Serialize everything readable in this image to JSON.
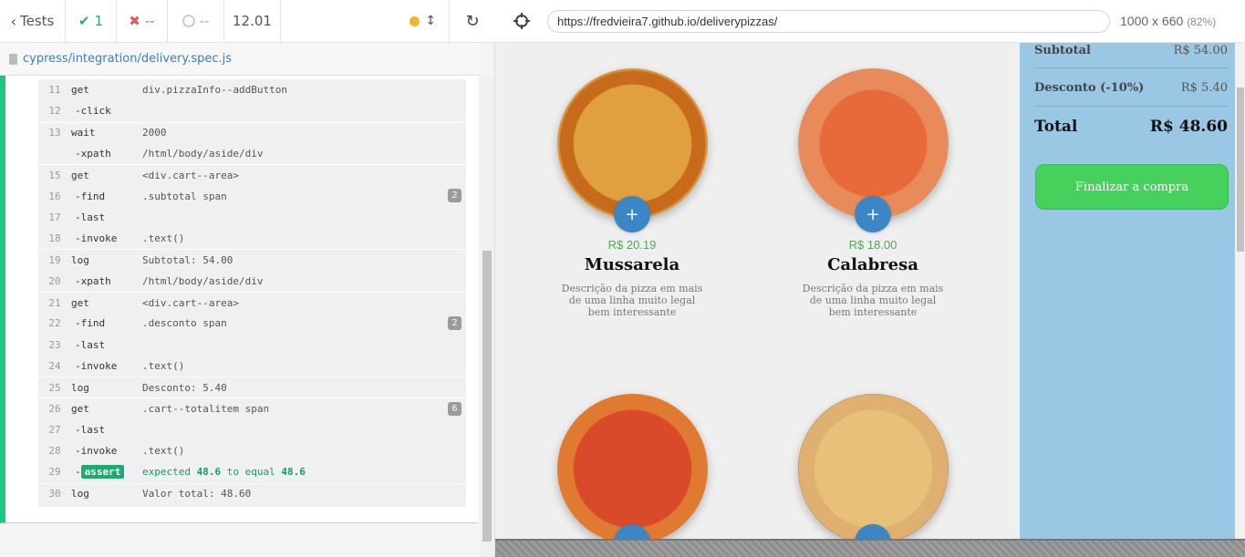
{
  "runner": {
    "tests_label": "Tests",
    "passed": "1",
    "failed": "--",
    "pending": "--",
    "duration": "12.01",
    "spec_path": "cypress/integration/delivery.spec.js"
  },
  "commands": [
    {
      "num": "11",
      "cmd": "get",
      "msg": "div.pizzaInfo--addButton",
      "sub": false
    },
    {
      "num": "12",
      "cmd": "-click",
      "msg": "",
      "sub": true
    },
    {
      "num": "13",
      "cmd": "wait",
      "msg": "2000",
      "sub": false
    },
    {
      "num": "",
      "cmd": "-xpath",
      "msg": "/html/body/aside/div",
      "sub": true
    },
    {
      "num": "15",
      "cmd": "get",
      "msg": "<div.cart--area>",
      "sub": false
    },
    {
      "num": "16",
      "cmd": "-find",
      "msg": ".subtotal span",
      "sub": true,
      "badge": "2"
    },
    {
      "num": "17",
      "cmd": "-last",
      "msg": "",
      "sub": true
    },
    {
      "num": "18",
      "cmd": "-invoke",
      "msg": ".text()",
      "sub": true
    },
    {
      "num": "19",
      "cmd": "log",
      "msg": "Subtotal: 54.00",
      "sub": false
    },
    {
      "num": "20",
      "cmd": "-xpath",
      "msg": "/html/body/aside/div",
      "sub": true
    },
    {
      "num": "21",
      "cmd": "get",
      "msg": "<div.cart--area>",
      "sub": false
    },
    {
      "num": "22",
      "cmd": "-find",
      "msg": ".desconto span",
      "sub": true,
      "badge": "2"
    },
    {
      "num": "23",
      "cmd": "-last",
      "msg": "",
      "sub": true
    },
    {
      "num": "24",
      "cmd": "-invoke",
      "msg": ".text()",
      "sub": true
    },
    {
      "num": "25",
      "cmd": "log",
      "msg": "Desconto: 5.40",
      "sub": false
    },
    {
      "num": "26",
      "cmd": "get",
      "msg": ".cart--totalitem span",
      "sub": false,
      "badge": "6"
    },
    {
      "num": "27",
      "cmd": "-last",
      "msg": "",
      "sub": true
    },
    {
      "num": "28",
      "cmd": "-invoke",
      "msg": ".text()",
      "sub": true
    },
    {
      "num": "29",
      "cmd": "assert",
      "msg": "",
      "sub": true,
      "assert": true
    },
    {
      "num": "30",
      "cmd": "log",
      "msg": "Valor total: 48.60",
      "sub": false
    }
  ],
  "assert_parts": {
    "expected": "expected",
    "v1": "48.6",
    "to_equal": "to equal",
    "v2": "48.6"
  },
  "browser": {
    "url": "https://fredvieira7.github.io/deliverypizzas/",
    "viewport": "1000 x 660",
    "zoom": "(82%)"
  },
  "pizzas": [
    {
      "price": "R$ 20.19",
      "name": "Mussarela",
      "desc": "Descrição da pizza em mais de uma linha muito legal bem interessante",
      "btn": "+"
    },
    {
      "price": "R$ 18.00",
      "name": "Calabresa",
      "desc": "Descrição da pizza em mais de uma linha muito legal bem interessante",
      "btn": "+"
    }
  ],
  "cart": {
    "subtotal_label": "Subtotal",
    "subtotal_value": "R$ 54.00",
    "discount_label": "Desconto (-10%)",
    "discount_value": "R$ 5.40",
    "total_label": "Total",
    "total_value": "R$ 48.60",
    "checkout_label": "Finalizar a compra"
  },
  "colors": {
    "pass": "#2fa67a",
    "fail": "#e05a5a",
    "accent": "#1fc67e",
    "cart_bg": "#9ac8e4",
    "buy": "#46d15c"
  }
}
